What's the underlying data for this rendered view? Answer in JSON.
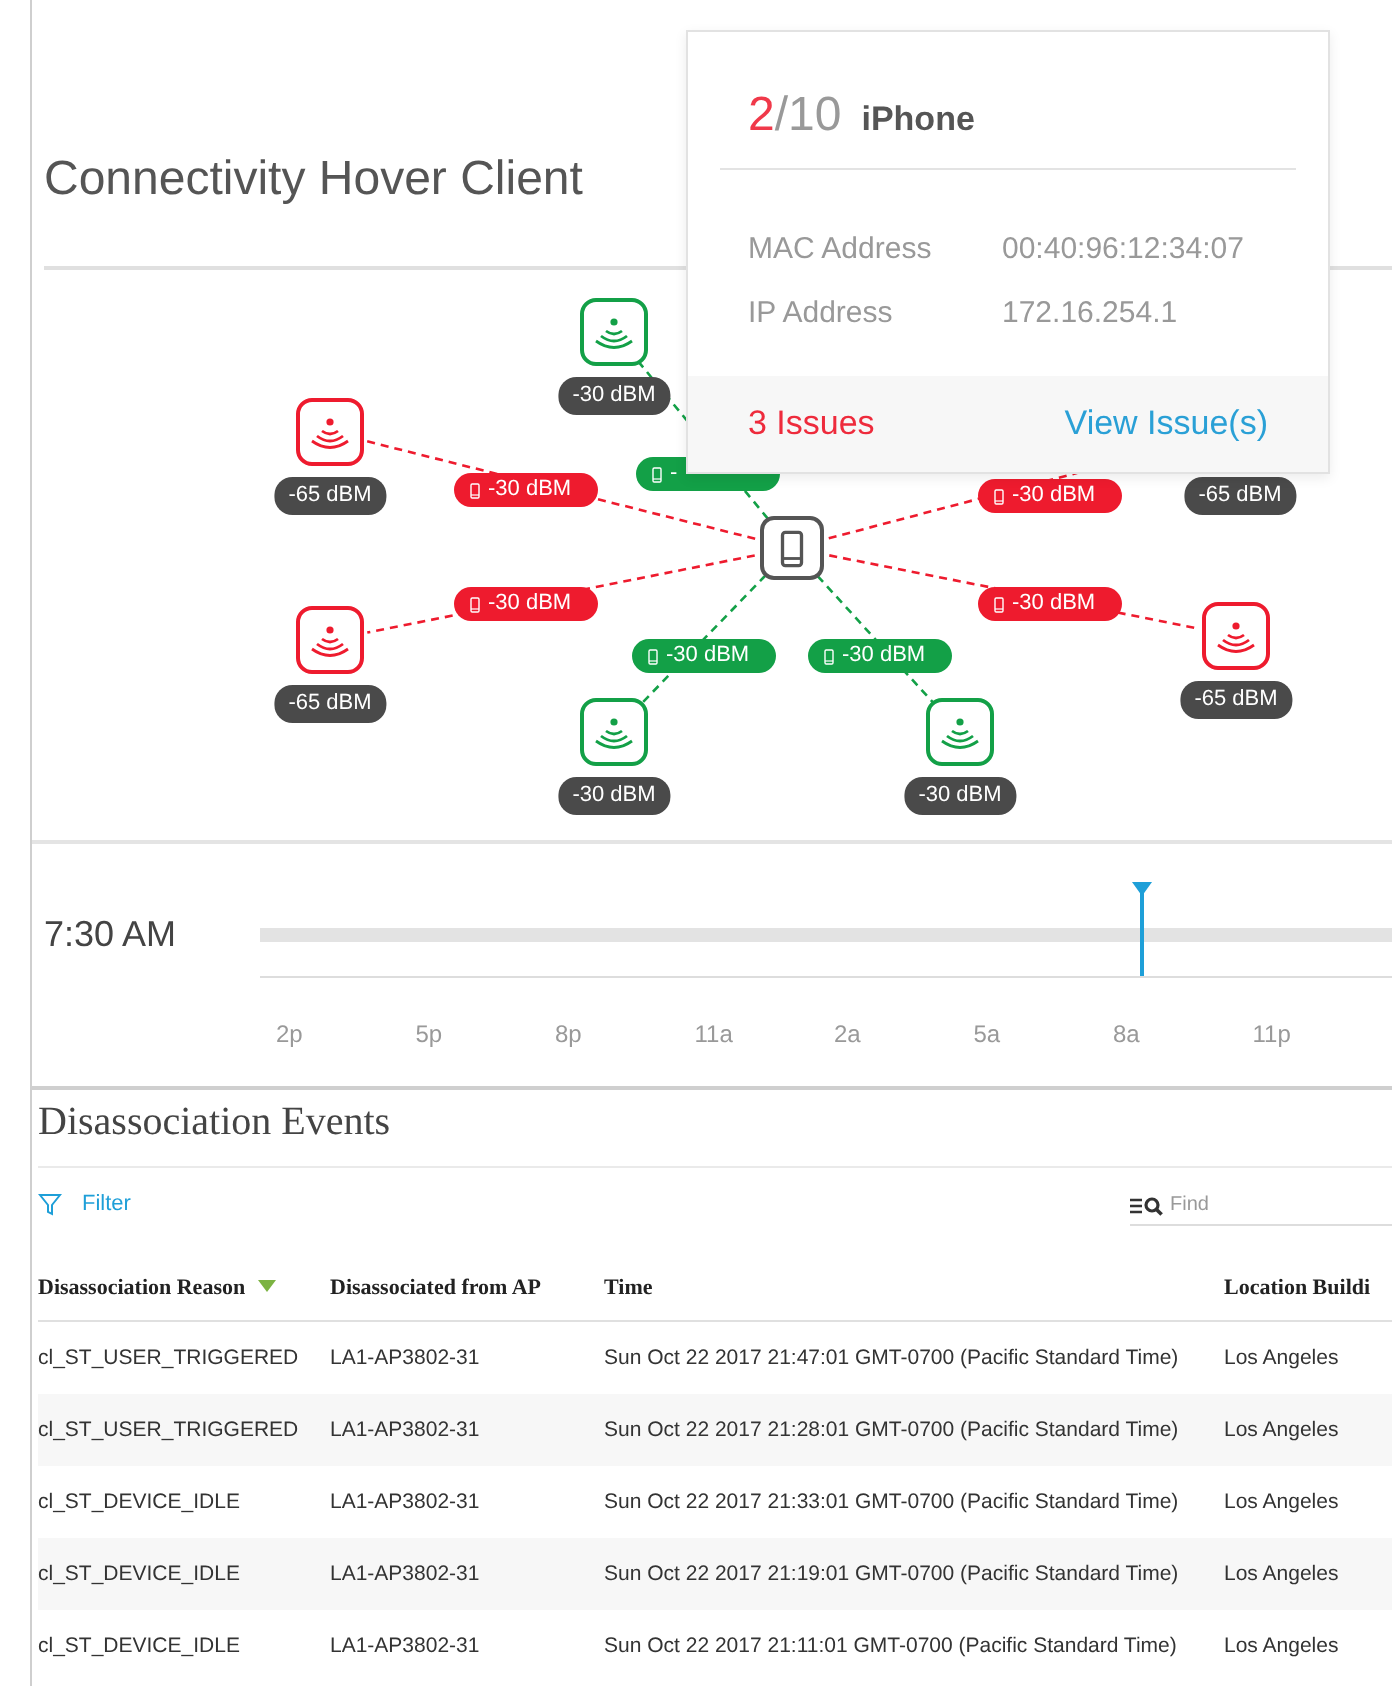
{
  "title": "Connectivity Hover Client",
  "diagram": {
    "access_points": [
      {
        "color": "#13a047",
        "signal": "-30 dBM",
        "link_signal": "-"
      },
      {
        "color": "#ee1b2e",
        "signal": "-65 dBM",
        "link_signal": "-30 dBM"
      },
      {
        "color": "#ee1b2e",
        "signal": "-65 dBM",
        "link_signal": "-30 dBM"
      },
      {
        "color": "#13a047",
        "signal": "-30 dBM",
        "link_signal": "-30 dBM"
      },
      {
        "color": "#13a047",
        "signal": "-30 dBM",
        "link_signal": "-30 dBM"
      },
      {
        "color": "#ee1b2e",
        "signal": "-65 dBM",
        "link_signal": "-30 dBM"
      },
      {
        "color": "#ee1b2e",
        "signal": "-65 dBM",
        "link_signal": "-30 dBM"
      }
    ]
  },
  "tooltip": {
    "score": "2",
    "score_total": "/10",
    "device": "iPhone",
    "fields": [
      {
        "label": "MAC Address",
        "value": "00:40:96:12:34:07"
      },
      {
        "label": "IP Address",
        "value": "172.16.254.1"
      }
    ],
    "issues": "3 Issues",
    "action": "View Issue(s)"
  },
  "timeline": {
    "time": "7:30 AM",
    "level": 0.78,
    "ticks": [
      "2p",
      "5p",
      "8p",
      "11a",
      "2a",
      "5a",
      "8a",
      "11p"
    ]
  },
  "events": {
    "title": "Disassociation Events",
    "filter": "Filter",
    "search": {
      "placeholder": "Find"
    },
    "columns": [
      {
        "label": "Disassociation Reason",
        "sorted": true
      },
      {
        "label": "Disassociated from AP",
        "sorted": false
      },
      {
        "label": "Time",
        "sorted": false
      },
      {
        "label": "Location Buildi",
        "sorted": false
      }
    ],
    "rows": [
      [
        "cl_ST_USER_TRIGGERED",
        "LA1-AP3802-31",
        "Sun Oct 22 2017 21:47:01 GMT-0700 (Pacific Standard Time)",
        "Los Angeles"
      ],
      [
        "cl_ST_USER_TRIGGERED",
        "LA1-AP3802-31",
        "Sun Oct 22 2017 21:28:01 GMT-0700 (Pacific Standard Time)",
        "Los Angeles"
      ],
      [
        "cl_ST_DEVICE_IDLE",
        "LA1-AP3802-31",
        "Sun Oct 22 2017 21:33:01 GMT-0700 (Pacific Standard Time)",
        "Los Angeles"
      ],
      [
        "cl_ST_DEVICE_IDLE",
        "LA1-AP3802-31",
        "Sun Oct 22 2017 21:19:01 GMT-0700 (Pacific Standard Time)",
        "Los Angeles"
      ],
      [
        "cl_ST_DEVICE_IDLE",
        "LA1-AP3802-31",
        "Sun Oct 22 2017 21:11:01 GMT-0700 (Pacific Standard Time)",
        "Los Angeles"
      ]
    ]
  }
}
